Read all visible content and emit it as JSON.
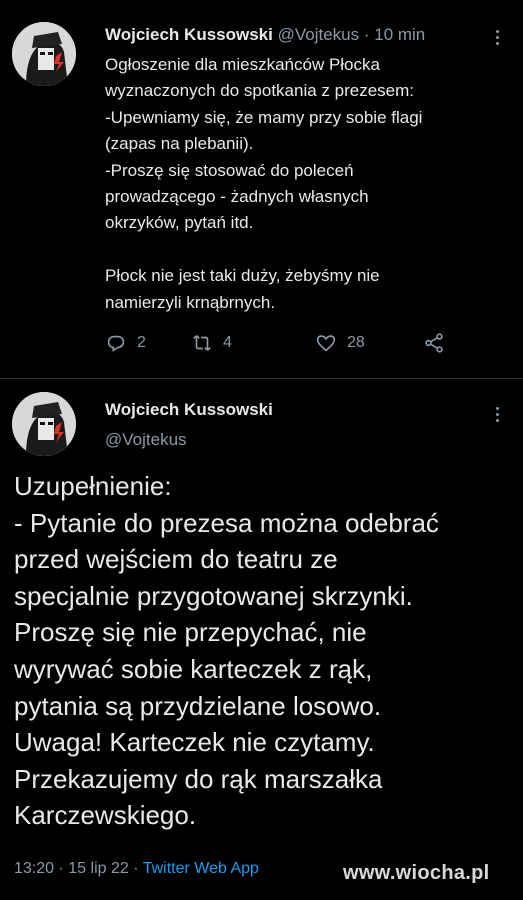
{
  "tweet1": {
    "author_name": "Wojciech Kussowski",
    "author_handle": "@Vojtekus",
    "time_sep": " · ",
    "time": "10 min",
    "lines": [
      "Ogłoszenie dla mieszkańców Płocka",
      "wyznaczonych do spotkania z prezesem:",
      "-Upewniamy się, że mamy przy sobie flagi",
      "(zapas na plebanii).",
      "-Proszę się stosować do poleceń",
      "prowadzącego - żadnych własnych",
      "okrzyków, pytań itd."
    ],
    "lines2": [
      "Płock nie jest taki duży, żebyśmy nie",
      "namierzyli krnąbrnych."
    ],
    "actions": {
      "replies": "2",
      "retweets": "4",
      "likes": "28",
      "reply_icon": "reply-icon",
      "retweet_icon": "retweet-icon",
      "like_icon": "heart-icon",
      "share_icon": "share-icon"
    }
  },
  "tweet2": {
    "author_name": "Wojciech Kussowski",
    "author_handle": "@Vojtekus",
    "lines": [
      "Uzupełnienie:",
      "- Pytanie do prezesa można odebrać",
      "przed wejściem do teatru ze",
      "specjalnie przygotowanej skrzynki.",
      "Proszę się nie przepychać, nie",
      "wyrywać sobie karteczek z rąk,",
      "pytania są przydzielane losowo.",
      "Uwaga! Karteczek nie czytamy.",
      "Przekazujemy do rąk marszałka",
      "Karczewskiego."
    ],
    "time": "13:20",
    "sep1": " · ",
    "date": "15 lip 22",
    "sep2": " · ",
    "app": "Twitter Web App"
  },
  "watermark": "www.wiocha.pl",
  "colors": {
    "background": "#000000",
    "text": "#e7e9ea",
    "secondary": "#8b98a5",
    "link": "#1d9bf0"
  }
}
